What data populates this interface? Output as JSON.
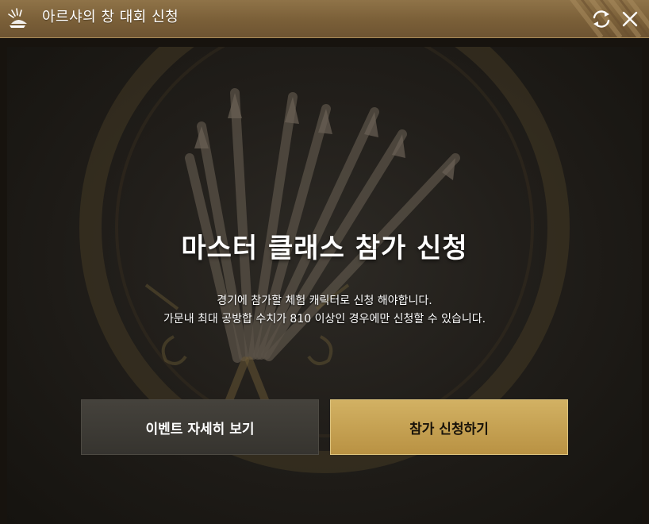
{
  "window": {
    "title": "아르샤의 창 대회 신청",
    "app_icon": "fan-icon",
    "refresh_icon": "refresh-icon",
    "close_icon": "close-icon"
  },
  "main": {
    "headline": "마스터 클래스 참가 신청",
    "description_line1": "경기에 참가할 체험 캐릭터로 신청 해야합니다.",
    "description_line2": "가문내 최대 공방합 수치가 810 이상인 경우에만 신청할 수 있습니다.",
    "background_emblem": "spear-crest-emblem"
  },
  "buttons": {
    "event_details_label": "이벤트 자세히 보기",
    "apply_label": "참가 신청하기"
  },
  "colors": {
    "titlebar": "#7f643c",
    "accent_gold": "#c8a455",
    "background": "#1f1c18"
  }
}
